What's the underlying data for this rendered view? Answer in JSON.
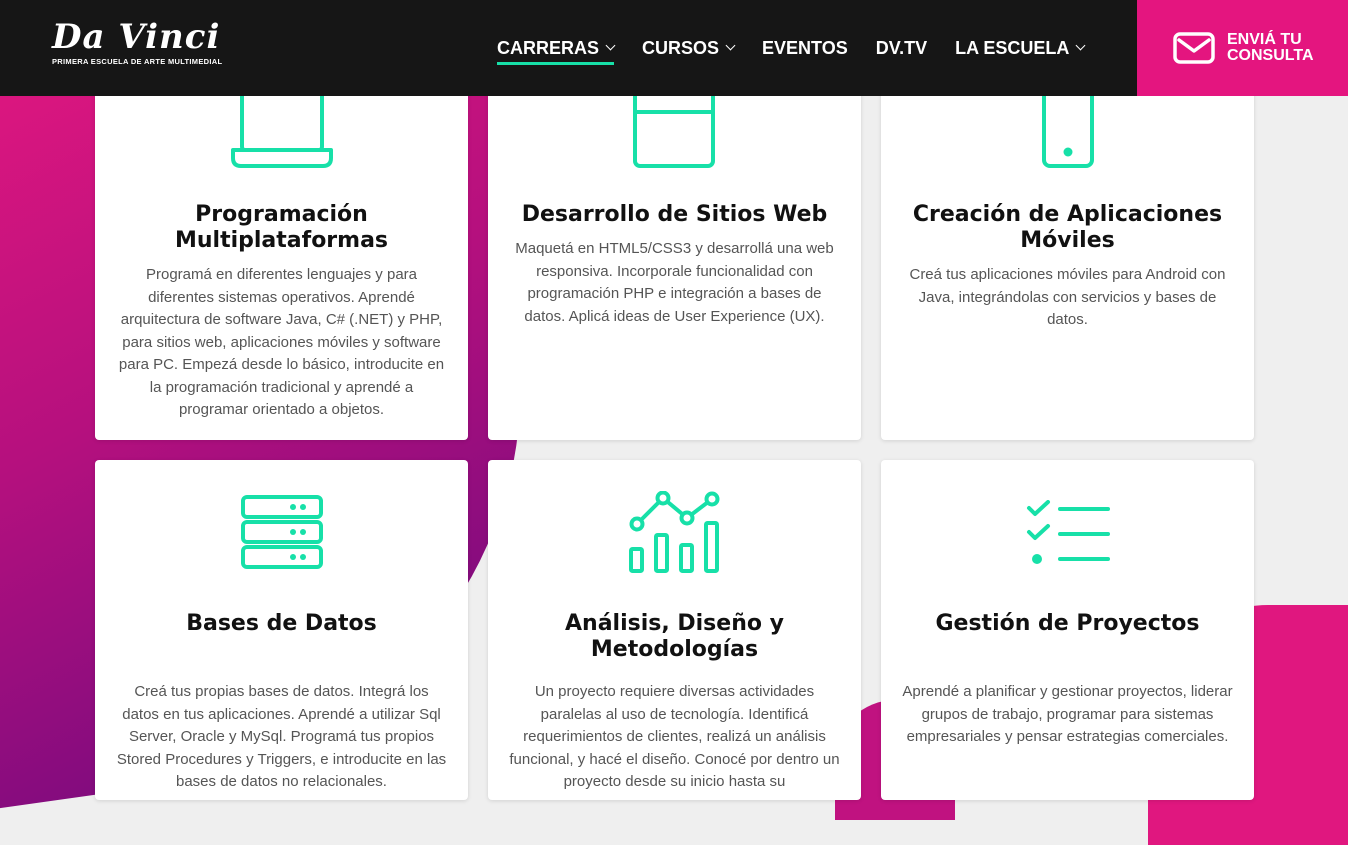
{
  "header": {
    "logo_text": "Da Vinci",
    "logo_subtitle": "PRIMERA ESCUELA DE ARTE MULTIMEDIAL",
    "nav": [
      {
        "label": "CARRERAS",
        "has_dropdown": true,
        "active": true
      },
      {
        "label": "CURSOS",
        "has_dropdown": true,
        "active": false
      },
      {
        "label": "EVENTOS",
        "has_dropdown": false,
        "active": false
      },
      {
        "label": "DV.TV",
        "has_dropdown": false,
        "active": false
      },
      {
        "label": "LA ESCUELA",
        "has_dropdown": true,
        "active": false
      }
    ],
    "cta_line1": "ENVIÁ TU",
    "cta_line2": "CONSULTA"
  },
  "colors": {
    "accent": "#17e0a8",
    "brand_pink": "#e4157f",
    "header_bg": "#161616"
  },
  "cards": [
    {
      "icon": "laptop-icon",
      "title": "Programación Multiplataformas",
      "text": "Programá en diferentes lenguajes y para diferentes sistemas operativos. Aprendé arquitectura de software Java, C# (.NET) y PHP, para sitios web, aplicaciones móviles y software para PC. Empezá desde lo básico, introducite en la programación tradicional y aprendé a programar orientado a objetos."
    },
    {
      "icon": "browser-window-icon",
      "title": "Desarrollo de Sitios Web",
      "text": "Maquetá en HTML5/CSS3 y desarrollá una web responsiva. Incorporale funcionalidad con programación PHP e integración a bases de datos. Aplicá ideas de User Experience (UX)."
    },
    {
      "icon": "smartphone-icon",
      "title": "Creación de Aplicaciones Móviles",
      "text": "Creá tus aplicaciones móviles para Android con Java, integrándolas con servicios y bases de datos."
    },
    {
      "icon": "database-server-icon",
      "title": "Bases de Datos",
      "text": "Creá tus propias bases de datos. Integrá los datos en tus aplicaciones. Aprendé a utilizar Sql Server, Oracle y MySql. Programá tus propios Stored Procedures y Triggers, e introducite en las bases de datos no relacionales."
    },
    {
      "icon": "analytics-chart-icon",
      "title": "Análisis, Diseño y Metodologías",
      "text": "Un proyecto requiere diversas actividades paralelas al uso de tecnología. Identificá requerimientos de clientes, realizá un análisis funcional, y hacé el diseño. Conocé por dentro un proyecto desde su inicio hasta su"
    },
    {
      "icon": "checklist-icon",
      "title": "Gestión de Proyectos",
      "text": "Aprendé a planificar y gestionar proyectos, liderar grupos de trabajo, programar para sistemas empresariales y pensar estrategias comerciales."
    }
  ]
}
